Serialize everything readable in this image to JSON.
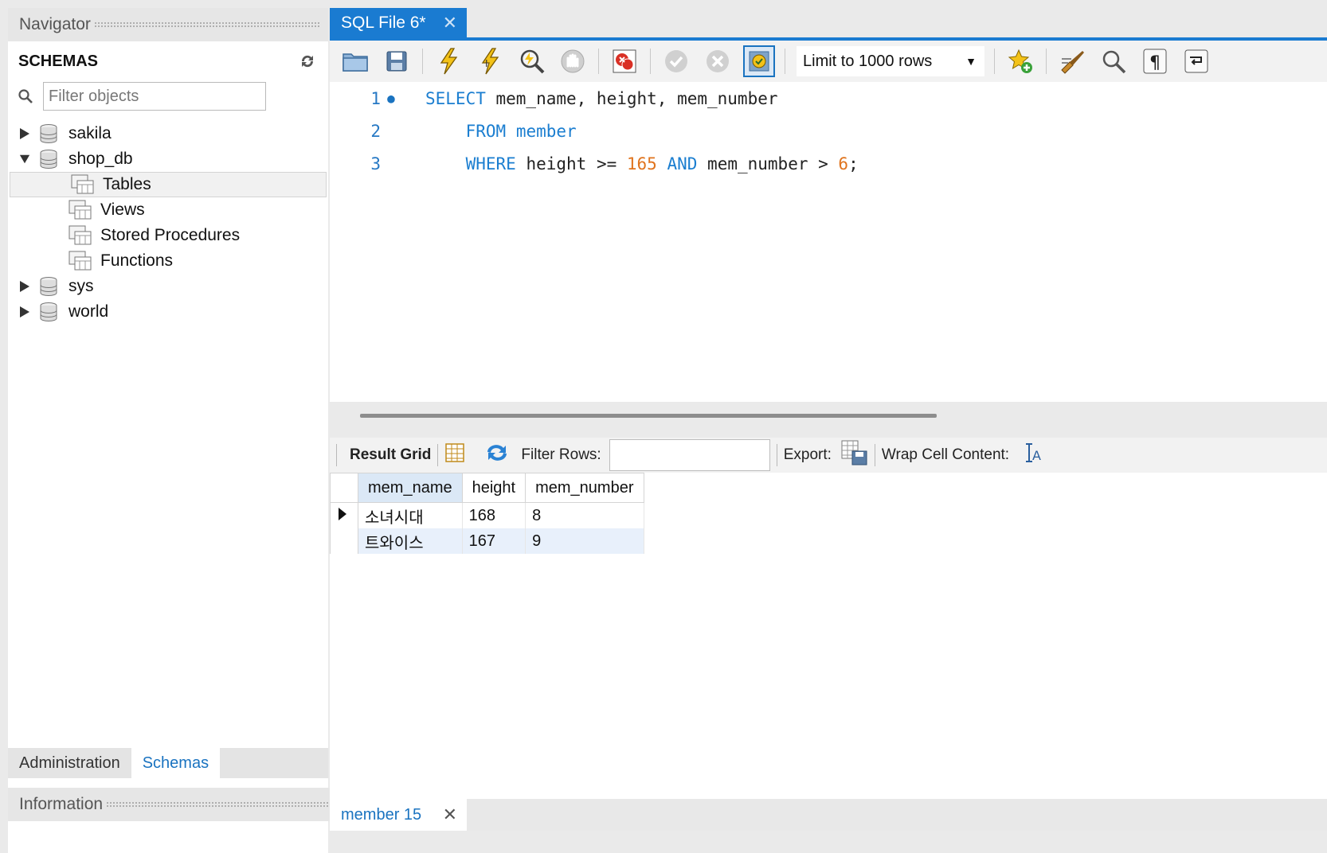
{
  "navigator": {
    "title": "Navigator",
    "schemas_title": "SCHEMAS",
    "filter_placeholder": "Filter objects",
    "tree": [
      {
        "label": "sakila",
        "expanded": false
      },
      {
        "label": "shop_db",
        "expanded": true,
        "children": [
          "Tables",
          "Views",
          "Stored Procedures",
          "Functions"
        ]
      },
      {
        "label": "sys",
        "expanded": false
      },
      {
        "label": "world",
        "expanded": false
      }
    ],
    "bottom_tabs": [
      "Administration",
      "Schemas"
    ],
    "active_bottom_tab": "Schemas",
    "info_title": "Information"
  },
  "editor": {
    "tab_title": "SQL File 6*",
    "limit_label": "Limit to 1000 rows",
    "toolbar_icons": [
      "open-file-icon",
      "save-icon",
      "execute-icon",
      "execute-current-icon",
      "explain-icon",
      "stop-icon",
      "toggle-error-icon",
      "commit-icon",
      "rollback-icon",
      "autocommit-icon",
      "add-snippet-icon",
      "beautify-icon",
      "find-icon",
      "invisible-chars-icon",
      "wrap-lines-icon"
    ],
    "lines": [
      {
        "num": "1",
        "tokens": [
          {
            "t": "SELECT",
            "c": "kw"
          },
          {
            "t": " mem_name, height, mem_number",
            "c": ""
          }
        ]
      },
      {
        "num": "2",
        "tokens": [
          {
            "t": "    ",
            "c": ""
          },
          {
            "t": "FROM",
            "c": "kw"
          },
          {
            "t": " ",
            "c": ""
          },
          {
            "t": "member",
            "c": "kw"
          }
        ]
      },
      {
        "num": "3",
        "tokens": [
          {
            "t": "    ",
            "c": ""
          },
          {
            "t": "WHERE",
            "c": "kw"
          },
          {
            "t": " height >= ",
            "c": ""
          },
          {
            "t": "165",
            "c": "num"
          },
          {
            "t": " ",
            "c": ""
          },
          {
            "t": "AND",
            "c": "kw"
          },
          {
            "t": " mem_number > ",
            "c": ""
          },
          {
            "t": "6",
            "c": "num"
          },
          {
            "t": ";",
            "c": ""
          }
        ]
      }
    ]
  },
  "result": {
    "grid_label": "Result Grid",
    "filter_rows_label": "Filter Rows:",
    "export_label": "Export:",
    "wrap_label": "Wrap Cell Content:",
    "columns": [
      "mem_name",
      "height",
      "mem_number"
    ],
    "rows": [
      [
        "소녀시대",
        "168",
        "8"
      ],
      [
        "트와이스",
        "167",
        "9"
      ]
    ],
    "tab_title": "member 15"
  },
  "colors": {
    "accent": "#1a7bd1",
    "keyword": "#1b7ed0",
    "number": "#e0741e"
  }
}
